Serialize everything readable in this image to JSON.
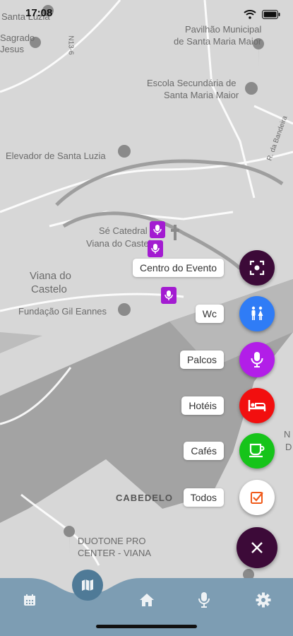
{
  "status": {
    "time": "17:08"
  },
  "map": {
    "labels": [
      "Santa Luzia",
      "Sagrado",
      "Jesus",
      "N13-6",
      "Pavilhão Municipal",
      "de Santa Maria Maior",
      "Escola Secundária de",
      "Santa Maria Maior",
      "Elevador de Santa Luzia",
      "R. da Bandeira",
      "Sé Catedral",
      "Viana do Castelo",
      "Viana do",
      "Castelo",
      "Fundação Gil Eannes",
      "CABEDELO",
      "DUOTONE PRO",
      "CENTER - VIANA",
      "N",
      "D"
    ]
  },
  "menu": {
    "items": [
      {
        "label": "Centro do Evento",
        "icon": "scan-icon",
        "color": "#3c0a38"
      },
      {
        "label": "Wc",
        "icon": "restroom-icon",
        "color": "#2f7cf6"
      },
      {
        "label": "Palcos",
        "icon": "microphone-icon",
        "color": "#b21ee8"
      },
      {
        "label": "Hotéis",
        "icon": "bed-icon",
        "color": "#f20f0f"
      },
      {
        "label": "Cafés",
        "icon": "coffee-icon",
        "color": "#16c41a"
      },
      {
        "label": "Todos",
        "icon": "checkbox-icon",
        "color": "#ffffff"
      }
    ],
    "close_icon": "close-icon"
  },
  "tabs": [
    "calendar-icon",
    "map-icon",
    "home-icon",
    "microphone-icon",
    "gear-icon"
  ],
  "colors": {
    "tabbar": "#7d9db3",
    "tab_active": "#4f7a97",
    "tab_icon": "#eef2f5"
  }
}
